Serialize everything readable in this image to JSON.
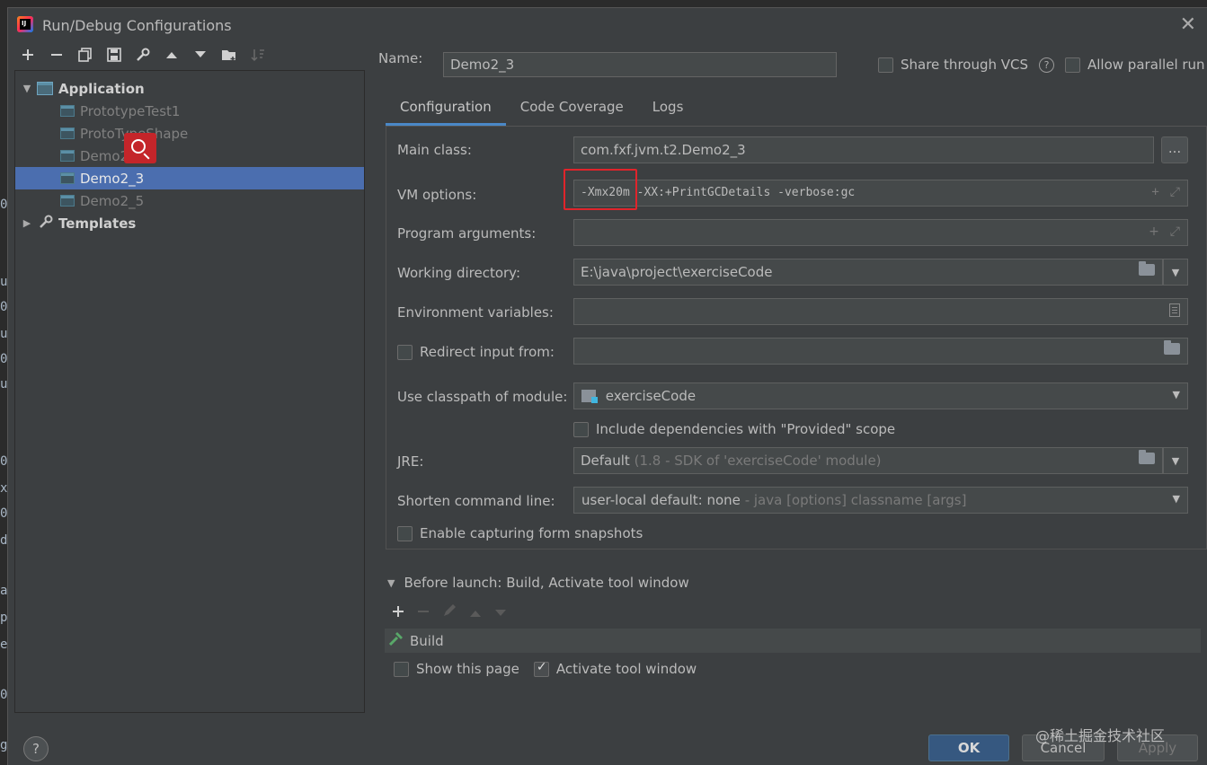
{
  "window": {
    "title": "Run/Debug Configurations",
    "close_glyph": "✕"
  },
  "left_strip": [
    "0",
    "u",
    "0",
    "u",
    "0",
    "u",
    "0",
    "x",
    "0",
    "d",
    "a",
    "p",
    "e",
    "0",
    "0",
    "g"
  ],
  "left_toolbar": {
    "icons": [
      "add-icon",
      "remove-icon",
      "copy-icon",
      "save-icon",
      "wrench-icon",
      "move-up-icon",
      "move-down-icon",
      "folder-add-icon",
      "sort-icon"
    ]
  },
  "tree": {
    "application_label": "Application",
    "items": [
      {
        "label": "PrototypeTest1",
        "selected": false
      },
      {
        "label": "ProtoTypeShape",
        "selected": false
      },
      {
        "label": "Demo2",
        "selected": false
      },
      {
        "label": "Demo2_3",
        "selected": true
      },
      {
        "label": "Demo2_5",
        "selected": false
      }
    ],
    "templates_label": "Templates"
  },
  "header": {
    "name_label": "Name:",
    "name_value": "Demo2_3",
    "share_vcs_label": "Share through VCS",
    "help_glyph": "?",
    "parallel_label": "Allow parallel run"
  },
  "tabs": [
    "Configuration",
    "Code Coverage",
    "Logs"
  ],
  "config": {
    "main_class_label": "Main class:",
    "main_class_value": "com.fxf.jvm.t2.Demo2_3",
    "browse_glyph": "...",
    "vm_options_label": "VM options:",
    "vm_options_value": "-Xmx20m -XX:+PrintGCDetails -verbose:gc",
    "program_args_label": "Program arguments:",
    "program_args_value": "",
    "working_dir_label": "Working directory:",
    "working_dir_value": "E:\\java\\project\\exerciseCode",
    "env_vars_label": "Environment variables:",
    "env_vars_value": "",
    "redirect_label": "Redirect input from:",
    "redirect_checked": false,
    "classpath_label": "Use classpath of module:",
    "classpath_value": "exerciseCode",
    "include_deps_label": "Include dependencies with \"Provided\" scope",
    "jre_label": "JRE:",
    "jre_value": "Default",
    "jre_hint": "(1.8 - SDK of 'exerciseCode' module)",
    "shorten_label": "Shorten command line:",
    "shorten_value": "user-local default: none",
    "shorten_hint": "- java [options] classname [args]",
    "capture_label": "Enable capturing form snapshots"
  },
  "before_launch": {
    "title": "Before launch: Build, Activate tool window",
    "task": "Build",
    "show_page_label": "Show this page",
    "show_page_checked": false,
    "activate_label": "Activate tool window",
    "activate_checked": true
  },
  "footer": {
    "help_glyph": "?",
    "ok_label": "OK",
    "cancel_label": "Cancel",
    "apply_label": "Apply",
    "watermark": "@稀土掘金技术社区"
  },
  "colors": {
    "background": "#3c3f41",
    "selection": "#4b6eaf",
    "accent": "#4a88c7",
    "highlight_box": "#e0242b",
    "ok_button": "#365880"
  }
}
